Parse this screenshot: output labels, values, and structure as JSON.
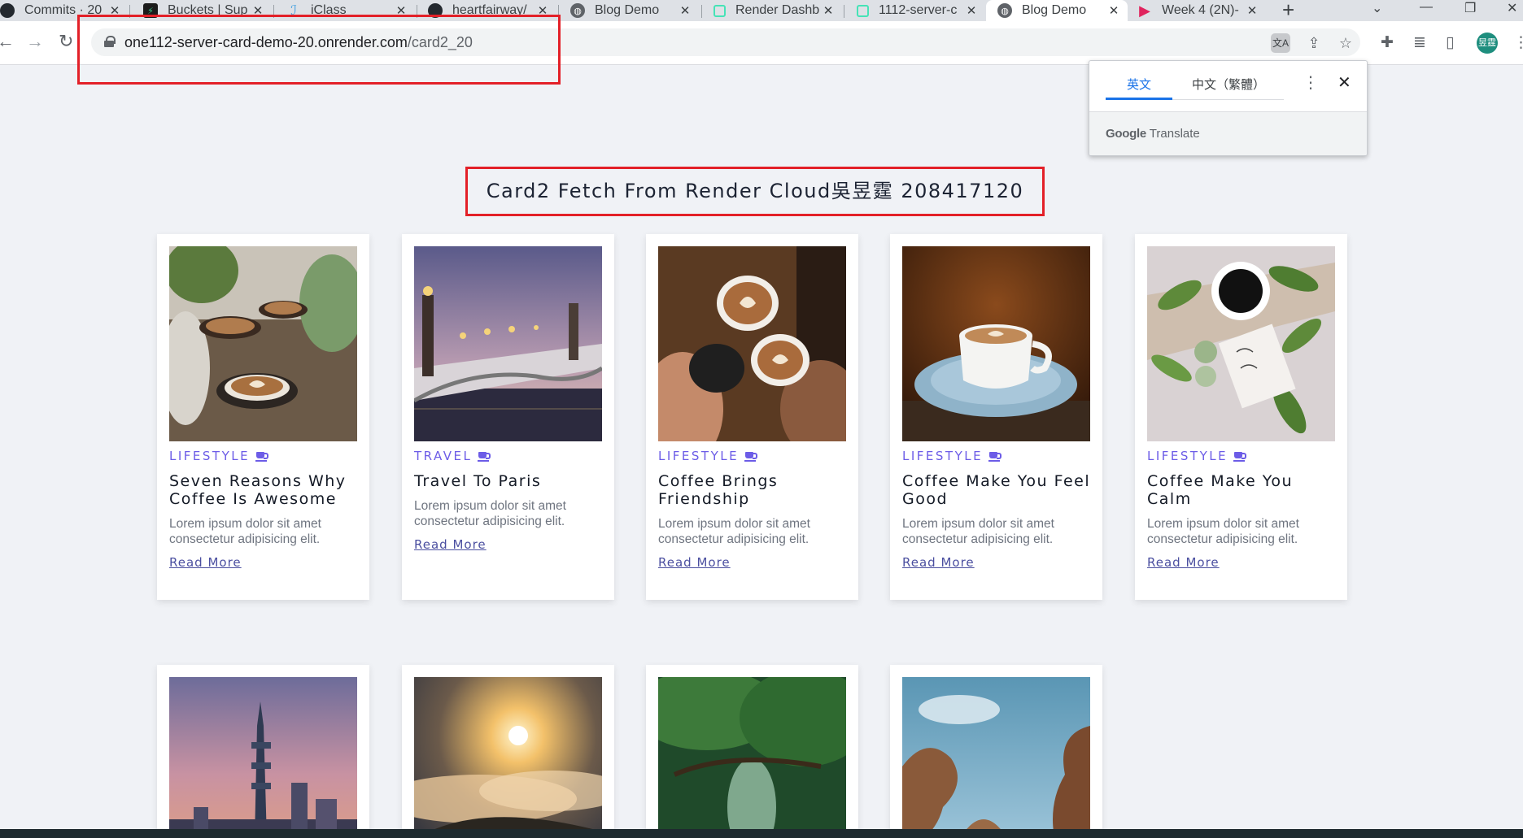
{
  "browser": {
    "tabs": [
      {
        "title": "Commits · 20",
        "favicon": "github-icon",
        "color": "#24292f"
      },
      {
        "title": "Buckets | Sup",
        "favicon": "supabase-icon",
        "color": "#3ecf8e"
      },
      {
        "title": "iClass",
        "favicon": "iclass-icon",
        "color": "#4aa3df"
      },
      {
        "title": "heartfairway/",
        "favicon": "github-icon",
        "color": "#24292f"
      },
      {
        "title": "Blog Demo",
        "favicon": "globe-icon",
        "color": "#5f6368"
      },
      {
        "title": "Render Dashb",
        "favicon": "render-icon",
        "color": "#46e3b7"
      },
      {
        "title": "1112-server-c",
        "favicon": "render-icon",
        "color": "#46e3b7"
      },
      {
        "title": "Blog Demo",
        "favicon": "globe-icon",
        "color": "#5f6368",
        "active": true
      },
      {
        "title": "Week 4 (2N)-",
        "favicon": "play-icon",
        "color": "#e0245e"
      }
    ],
    "url": {
      "host": "one112-server-card-demo-20.onrender.com",
      "path": "/card2_20"
    },
    "profile_initials": "昱霆"
  },
  "translate_popup": {
    "source_lang": "英文",
    "target_lang": "中文（繁體）",
    "brand_google": "Google",
    "brand_product": "Translate"
  },
  "page": {
    "title": "Card2 Fetch From Render Cloud吳昱霆 208417120",
    "read_more_label": "Read More",
    "accent_color": "#6c5ce7",
    "cards": [
      {
        "category": "LIFESTYLE",
        "title": "Seven Reasons Why Coffee Is Awesome",
        "desc": "Lorem ipsum dolor sit amet consectetur adipisicing elit.",
        "image": "coffee-cups-plants"
      },
      {
        "category": "TRAVEL",
        "title": "Travel To Paris",
        "desc": "Lorem ipsum dolor sit amet consectetur adipisicing elit.",
        "image": "paris-bridge-dusk"
      },
      {
        "category": "LIFESTYLE",
        "title": "Coffee Brings Friendship",
        "desc": "Lorem ipsum dolor sit amet consectetur adipisicing elit.",
        "image": "hands-latte-cheers"
      },
      {
        "category": "LIFESTYLE",
        "title": "Coffee Make You Feel Good",
        "desc": "Lorem ipsum dolor sit amet consectetur adipisicing elit.",
        "image": "cup-blue-saucer"
      },
      {
        "category": "LIFESTYLE",
        "title": "Coffee Make You Calm",
        "desc": "Lorem ipsum dolor sit amet consectetur adipisicing elit.",
        "image": "coffee-leaves-note"
      }
    ],
    "cards_row2": [
      {
        "image": "taipei-101-skyline"
      },
      {
        "image": "sunrise-sea-of-clouds"
      },
      {
        "image": "green-forest-river"
      },
      {
        "image": "rock-formations-sky"
      }
    ]
  }
}
